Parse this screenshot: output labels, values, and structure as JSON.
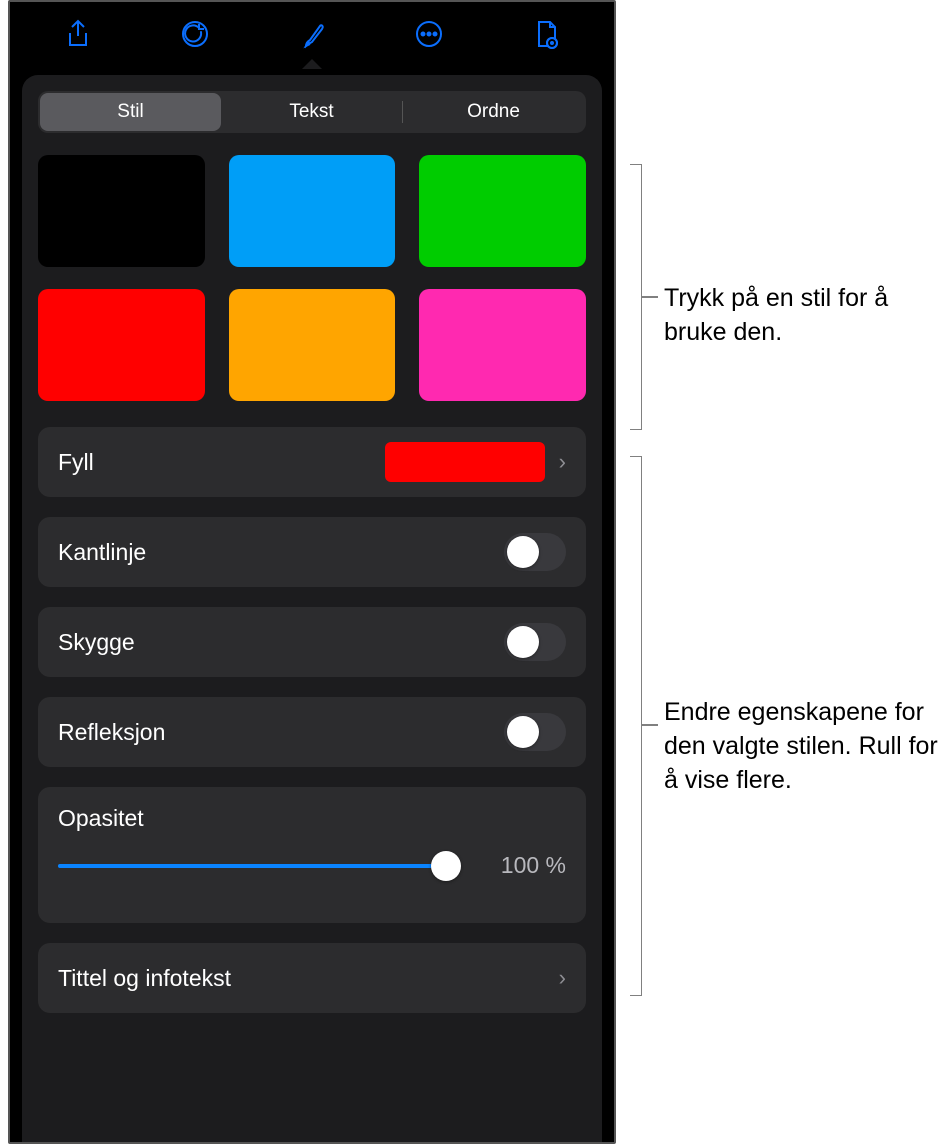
{
  "tabs": {
    "style": "Stil",
    "text": "Tekst",
    "arrange": "Ordne"
  },
  "swatches": [
    "#000000",
    "#009ef7",
    "#00cc00",
    "#ff0000",
    "#ffa500",
    "#ff29b0"
  ],
  "fill": {
    "label": "Fyll",
    "color": "#ff0000"
  },
  "border": {
    "label": "Kantlinje"
  },
  "shadow": {
    "label": "Skygge"
  },
  "reflection": {
    "label": "Refleksjon"
  },
  "opacity": {
    "label": "Opasitet",
    "value": "100 %"
  },
  "title_caption": {
    "label": "Tittel og infotekst"
  },
  "callouts": {
    "styles": "Trykk på en stil for å bruke den.",
    "properties": "Endre egenskapene for den valgte stilen. Rull for å vise flere."
  }
}
